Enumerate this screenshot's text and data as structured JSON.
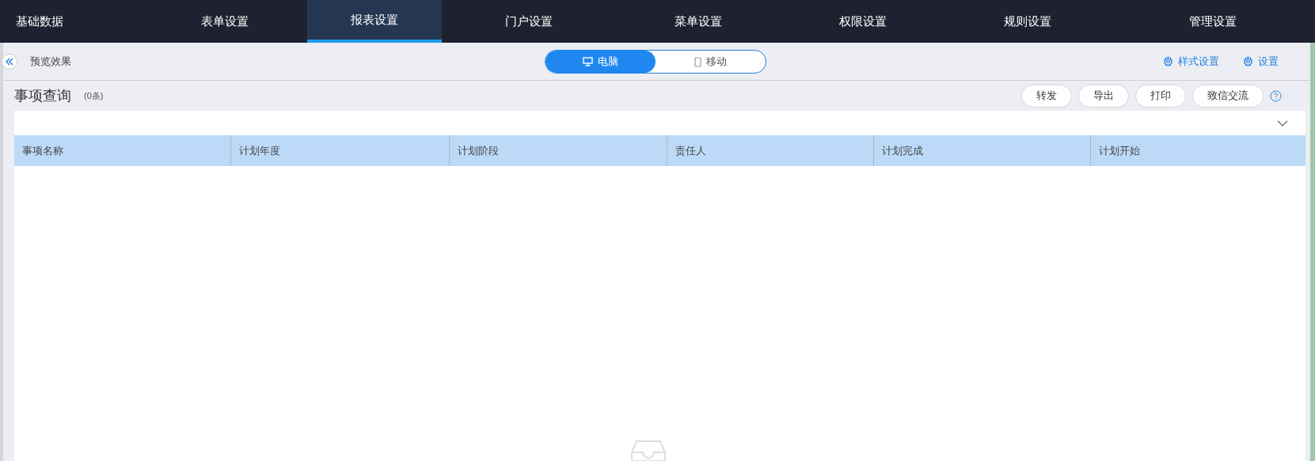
{
  "nav": [
    {
      "label": "基础数据",
      "selected": false
    },
    {
      "label": "表单设置",
      "selected": false
    },
    {
      "label": "报表设置",
      "selected": true
    },
    {
      "label": "门户设置",
      "selected": false
    },
    {
      "label": "菜单设置",
      "selected": false
    },
    {
      "label": "权限设置",
      "selected": false
    },
    {
      "label": "规则设置",
      "selected": false
    },
    {
      "label": "管理设置",
      "selected": false
    }
  ],
  "toolbar": {
    "title": "预览效果",
    "devices": [
      {
        "label": "电脑",
        "kind": "desktop",
        "selected": true
      },
      {
        "label": "移动",
        "kind": "mobile",
        "selected": false
      }
    ],
    "links": [
      "样式设置",
      "设置"
    ]
  },
  "report": {
    "title": "事项查询",
    "count": "(0条)",
    "actions": [
      "转发",
      "导出",
      "打印",
      "致信交流"
    ]
  },
  "table": {
    "columns": [
      "事项名称",
      "计划年度",
      "计划阶段",
      "责任人",
      "计划完成",
      "计划开始"
    ]
  }
}
